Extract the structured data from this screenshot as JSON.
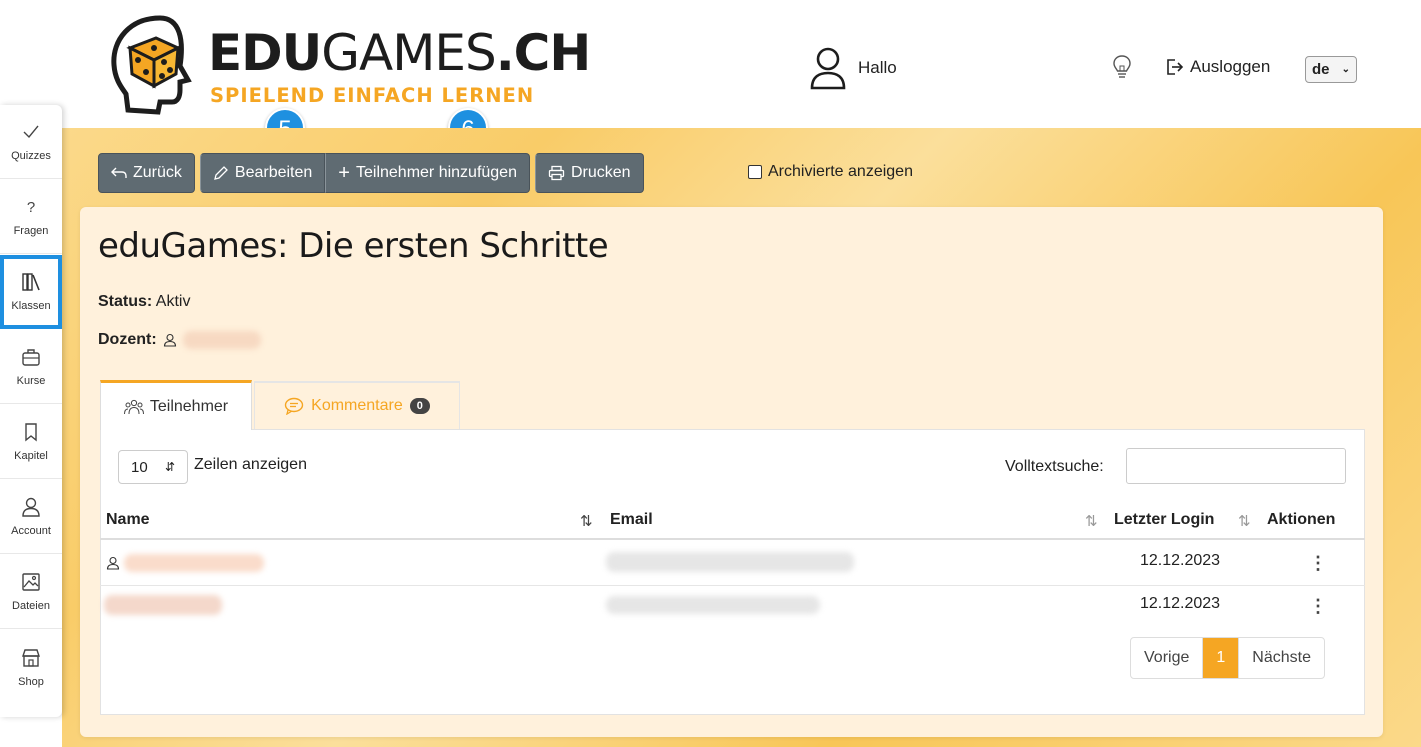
{
  "header": {
    "logo_text_bold": "EDU",
    "logo_text_light": "GAMES",
    "logo_text_suffix": ".CH",
    "logo_tagline": "SPIELEND EINFACH LERNEN",
    "greeting": "Hallo",
    "logout_label": "Ausloggen",
    "language": "de"
  },
  "step_badges": [
    "5",
    "6"
  ],
  "sidebar": {
    "items": [
      {
        "label": "Quizzes",
        "icon": "check-icon"
      },
      {
        "label": "Fragen",
        "icon": "question-icon"
      },
      {
        "label": "Klassen",
        "icon": "books-icon",
        "active": true
      },
      {
        "label": "Kurse",
        "icon": "briefcase-icon"
      },
      {
        "label": "Kapitel",
        "icon": "bookmark-icon"
      },
      {
        "label": "Account",
        "icon": "user-icon"
      },
      {
        "label": "Dateien",
        "icon": "image-icon"
      },
      {
        "label": "Shop",
        "icon": "store-icon"
      }
    ]
  },
  "toolbar": {
    "back_label": "Zurück",
    "edit_label": "Bearbeiten",
    "add_label": "Teilnehmer hinzufügen",
    "print_label": "Drucken",
    "archived_label": "Archivierte anzeigen"
  },
  "class": {
    "title": "eduGames: Die ersten Schritte",
    "status_label": "Status:",
    "status_value": "Aktiv",
    "lecturer_label": "Dozent:"
  },
  "tabs": {
    "participants_label": "Teilnehmer",
    "comments_label": "Kommentare",
    "comments_count": "0"
  },
  "table": {
    "rows_per_page": "10",
    "rows_label": "Zeilen anzeigen",
    "search_label": "Volltextsuche:",
    "search_value": "",
    "columns": [
      "Name",
      "Email",
      "Letzter Login",
      "Aktionen"
    ],
    "rows": [
      {
        "last_login": "12.12.2023"
      },
      {
        "last_login": "12.12.2023"
      }
    ]
  },
  "pagination": {
    "prev_label": "Vorige",
    "current_page": "1",
    "next_label": "Nächste"
  },
  "colors": {
    "accent": "#f5a623",
    "step_badge": "#1e90e0",
    "toolbar_button": "#5f6b72",
    "active_outline": "#1e8fe0"
  }
}
